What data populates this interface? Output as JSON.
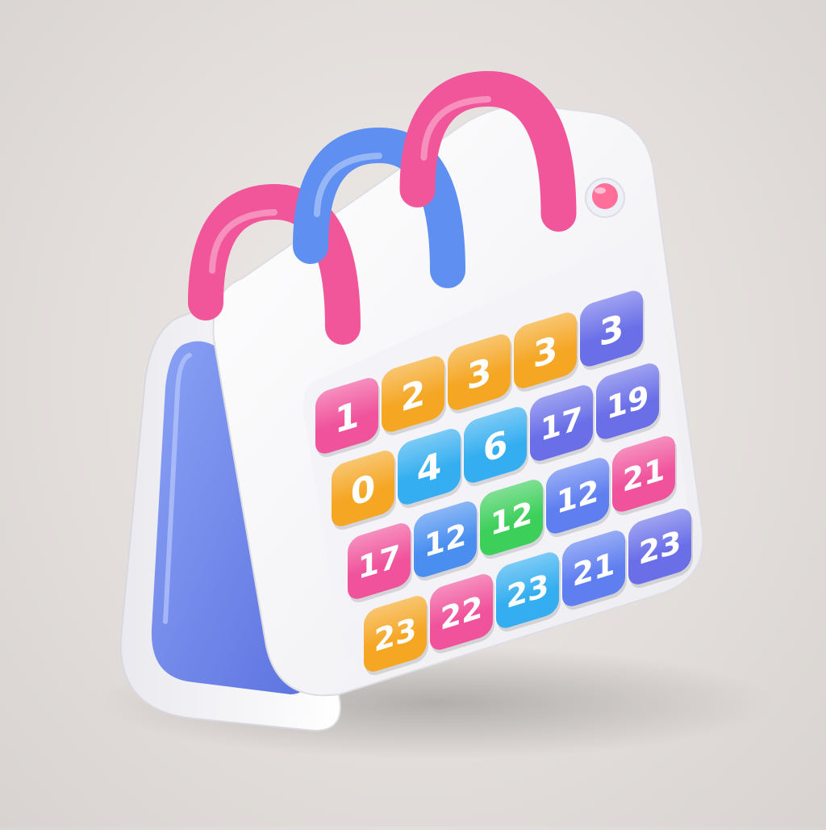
{
  "colors": {
    "background": "#e6e2df",
    "body": "#f6f6f8",
    "stand_blue": "#6e86ea",
    "ring_pink": "#f2569a",
    "ring_blue": "#5f8ff0",
    "indicator": "#ff6f9a"
  },
  "rings": [
    {
      "icon": "binder-ring-icon",
      "color": "#f2569a"
    },
    {
      "icon": "binder-ring-icon",
      "color": "#5f8ff0"
    },
    {
      "icon": "binder-ring-icon",
      "color": "#f2569a"
    }
  ],
  "indicator": {
    "icon": "indicator-dot-icon",
    "color": "#ff6f9a"
  },
  "tiles": [
    {
      "label": "1",
      "color": "#f0529b"
    },
    {
      "label": "2",
      "color": "#f5a623"
    },
    {
      "label": "3",
      "color": "#f5a623"
    },
    {
      "label": "3",
      "color": "#f5a623"
    },
    {
      "label": "3",
      "color": "#6a6fe8"
    },
    {
      "label": "0",
      "color": "#f5a623"
    },
    {
      "label": "4",
      "color": "#34aef0"
    },
    {
      "label": "6",
      "color": "#34aef0"
    },
    {
      "label": "17",
      "color": "#6a6fe8"
    },
    {
      "label": "19",
      "color": "#6a6fe8"
    },
    {
      "label": "17",
      "color": "#f0529b"
    },
    {
      "label": "12",
      "color": "#4a8ff0"
    },
    {
      "label": "12",
      "color": "#3ccf5a"
    },
    {
      "label": "12",
      "color": "#5f7ff0"
    },
    {
      "label": "21",
      "color": "#f0529b"
    },
    {
      "label": "23",
      "color": "#f5a623"
    },
    {
      "label": "22",
      "color": "#f0529b"
    },
    {
      "label": "23",
      "color": "#34aef0"
    },
    {
      "label": "21",
      "color": "#5f7ff0"
    },
    {
      "label": "23",
      "color": "#6a6fe8"
    }
  ]
}
